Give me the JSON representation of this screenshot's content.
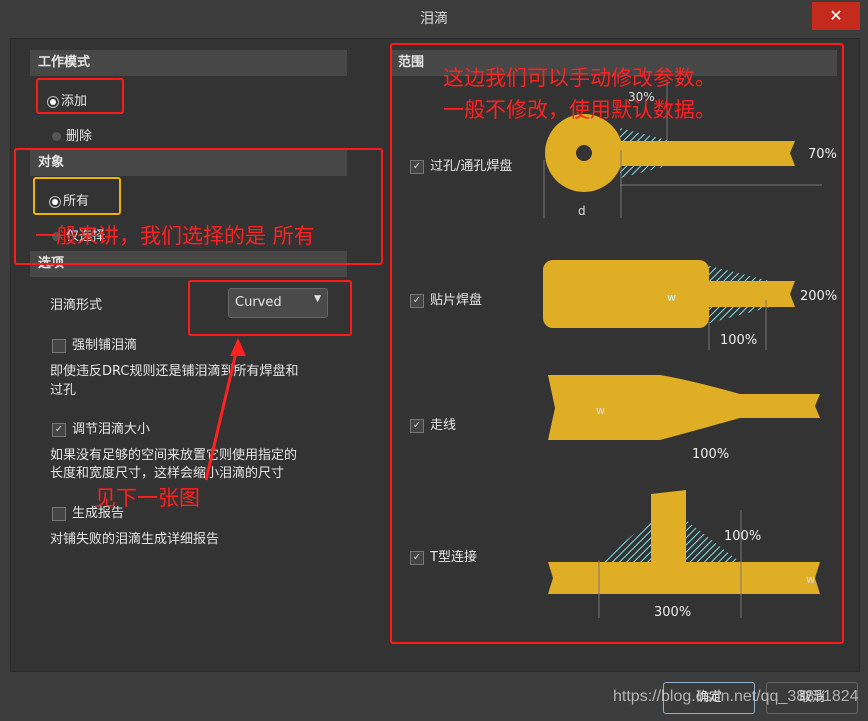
{
  "window": {
    "title": "泪滴",
    "close_icon": "close-icon"
  },
  "left": {
    "mode": {
      "header": "工作模式",
      "options": [
        {
          "label": "添加",
          "selected": true
        },
        {
          "label": "删除",
          "selected": false
        }
      ]
    },
    "object": {
      "header": "对象",
      "options": [
        {
          "label": "所有",
          "selected": true
        },
        {
          "label": "仅选择",
          "selected": false
        }
      ]
    },
    "options": {
      "header": "选项",
      "style_label": "泪滴形式",
      "style_value": "Curved",
      "force": {
        "label": "强制铺泪滴",
        "checked": false,
        "desc1": "即使违反DRC规则还是铺泪滴到所有焊盘和",
        "desc2": "过孔"
      },
      "adjust": {
        "label": "调节泪滴大小",
        "checked": true,
        "desc1": "如果没有足够的空间来放置它则使用指定的",
        "desc2": "长度和宽度尺寸，这样会缩小泪滴的尺寸"
      },
      "report": {
        "label": "生成报告",
        "checked": false,
        "desc": "对铺失败的泪滴生成详细报告"
      }
    }
  },
  "right": {
    "header": "范围",
    "items": [
      {
        "label": "过孔/通孔焊盘",
        "checked": true,
        "len": "30%",
        "width": "70%",
        "dim": "d"
      },
      {
        "label": "贴片焊盘",
        "checked": true,
        "len": "100%",
        "width": "200%",
        "dim": "w"
      },
      {
        "label": "走线",
        "checked": true,
        "len": "100%",
        "dim": "w"
      },
      {
        "label": "T型连接",
        "checked": true,
        "len": "300%",
        "width": "100%",
        "dim": "w"
      }
    ]
  },
  "annotations": {
    "a1": "一般来讲，我们选择的是 所有",
    "a2": "这边我们可以手动修改参数。",
    "a3": "一般不修改，使用默认数据。",
    "a4": "见下一张图",
    "color": "#ff2020"
  },
  "footer": {
    "ok": "确定",
    "cancel": "取消",
    "watermark": "https://blog.csdn.net/qq_38851824"
  }
}
